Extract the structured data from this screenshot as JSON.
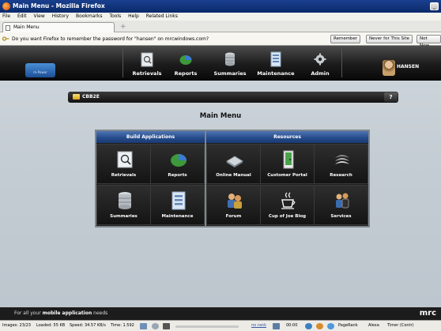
{
  "browser": {
    "title": "Main Menu - Mozilla Firefox",
    "menu": [
      "File",
      "Edit",
      "View",
      "History",
      "Bookmarks",
      "Tools",
      "Help",
      "Related Links"
    ],
    "tab_title": "Main Menu",
    "new_tab": "+"
  },
  "notification": {
    "message": "Do you want Firefox to remember the password for \"hansen\" on mrcwindows.com?",
    "buttons": [
      "Remember",
      "Never for This Site",
      "Not Now"
    ]
  },
  "app_nav": {
    "logo_text": "m-Power",
    "items": [
      {
        "label": "Retrievals",
        "icon": "retrievals-icon"
      },
      {
        "label": "Reports",
        "icon": "reports-icon"
      },
      {
        "label": "Summaries",
        "icon": "summaries-icon"
      },
      {
        "label": "Maintenance",
        "icon": "maintenance-icon"
      },
      {
        "label": "Admin",
        "icon": "admin-icon"
      }
    ],
    "user": "HANSEN"
  },
  "breadcrumb": {
    "label": "CBB2E",
    "help": "?"
  },
  "page_title": "Main Menu",
  "panel": {
    "build_header": "Build Applications",
    "resources_header": "Resources",
    "build_tiles": [
      {
        "label": "Retrievals",
        "icon": "retrievals-icon"
      },
      {
        "label": "Reports",
        "icon": "reports-icon"
      },
      {
        "label": "Summaries",
        "icon": "summaries-icon"
      },
      {
        "label": "Maintenance",
        "icon": "maintenance-icon"
      }
    ],
    "resource_tiles": [
      {
        "label": "Online Manual",
        "icon": "manual-icon"
      },
      {
        "label": "Customer Portal",
        "icon": "portal-icon"
      },
      {
        "label": "Research",
        "icon": "research-icon"
      },
      {
        "label": "Forum",
        "icon": "forum-icon"
      },
      {
        "label": "Cup of Joe Blog",
        "icon": "coffee-icon"
      },
      {
        "label": "Services",
        "icon": "services-icon"
      }
    ]
  },
  "ad": {
    "prefix": "For all your ",
    "bold": "mobile application",
    "suffix": " needs",
    "logo": "mrc"
  },
  "status": {
    "images": "Images: 23/23",
    "loaded": "Loaded: 55 KB",
    "speed": "Speed: 34.57 KB/s",
    "time": "Time: 1.592",
    "rank": "no rank",
    "clock": "00:00",
    "pagerank": "PageRank",
    "alexa": "Alexa",
    "timeout": "Timer (Contr)"
  },
  "colors": {
    "section_header": "#244a8a",
    "nav_bg": "#1c1c1c",
    "content_bg": "#c5cdd4"
  }
}
